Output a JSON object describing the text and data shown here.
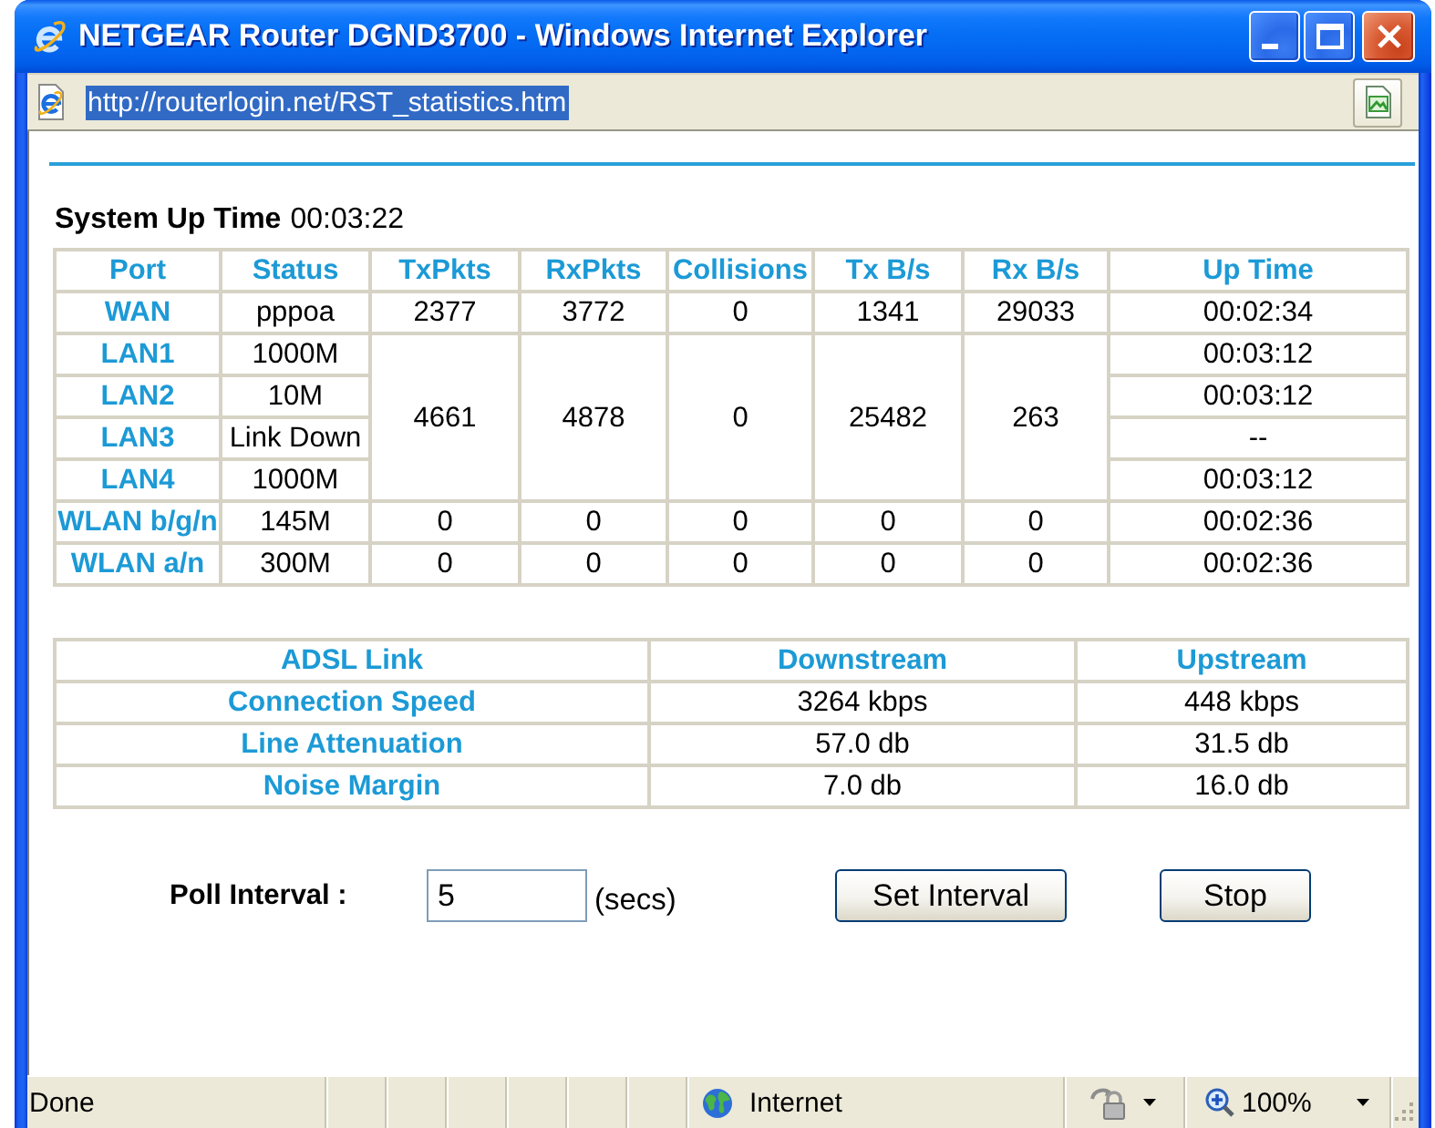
{
  "window": {
    "title": "NETGEAR Router DGND3700 - Windows Internet Explorer"
  },
  "address_bar": {
    "url": "http://routerlogin.net/RST_statistics.htm",
    "url_selected": true
  },
  "system_up_time": {
    "label": "System Up Time",
    "value": "00:03:22"
  },
  "port_table": {
    "columns": [
      "Port",
      "Status",
      "TxPkts",
      "RxPkts",
      "Collisions",
      "Tx B/s",
      "Rx B/s",
      "Up Time"
    ],
    "groups": [
      {
        "rows": [
          {
            "port": "WAN",
            "status": "pppoa",
            "up_time": "00:02:34"
          }
        ],
        "counters": [
          "2377",
          "3772",
          "0",
          "1341",
          "29033"
        ]
      },
      {
        "rows": [
          {
            "port": "LAN1",
            "status": "1000M",
            "up_time": "00:03:12"
          },
          {
            "port": "LAN2",
            "status": "10M",
            "up_time": "00:03:12"
          },
          {
            "port": "LAN3",
            "status": "Link Down",
            "up_time": "--"
          },
          {
            "port": "LAN4",
            "status": "1000M",
            "up_time": "00:03:12"
          }
        ],
        "counters": [
          "4661",
          "4878",
          "0",
          "25482",
          "263"
        ]
      },
      {
        "rows": [
          {
            "port": "WLAN b/g/n",
            "status": "145M",
            "up_time": "00:02:36"
          }
        ],
        "counters": [
          "0",
          "0",
          "0",
          "0",
          "0"
        ]
      },
      {
        "rows": [
          {
            "port": "WLAN a/n",
            "status": "300M",
            "up_time": "00:02:36"
          }
        ],
        "counters": [
          "0",
          "0",
          "0",
          "0",
          "0"
        ]
      }
    ]
  },
  "adsl_table": {
    "columns": [
      "ADSL Link",
      "Downstream",
      "Upstream"
    ],
    "rows": [
      {
        "label": "Connection Speed",
        "values": [
          "3264 kbps",
          "448 kbps"
        ]
      },
      {
        "label": "Line Attenuation",
        "values": [
          "57.0 db",
          "31.5 db"
        ]
      },
      {
        "label": "Noise Margin",
        "values": [
          "7.0 db",
          "16.0 db"
        ]
      }
    ]
  },
  "poll": {
    "label": "Poll Interval :",
    "value": "5",
    "unit": "(secs)",
    "buttons": [
      "Set Interval",
      "Stop"
    ]
  },
  "status_bar": {
    "text": "Done",
    "zone": "Internet",
    "zoom": "100%"
  }
}
